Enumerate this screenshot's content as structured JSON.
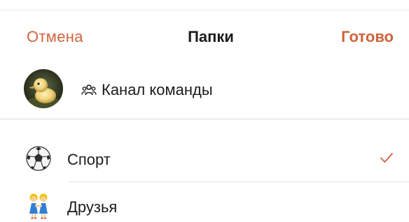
{
  "colors": {
    "accent": "#d0633c",
    "text": "#1c1c1e"
  },
  "nav": {
    "cancel_label": "Отмена",
    "title": "Папки",
    "done_label": "Готово"
  },
  "chat": {
    "title": "Канал команды",
    "avatar": "duckling-photo",
    "icon": "group-icon"
  },
  "folders": [
    {
      "label": "Спорт",
      "icon": "soccer-ball-icon",
      "selected": true
    },
    {
      "label": "Друзья",
      "icon": "friends-emoji-icon",
      "selected": false
    }
  ]
}
